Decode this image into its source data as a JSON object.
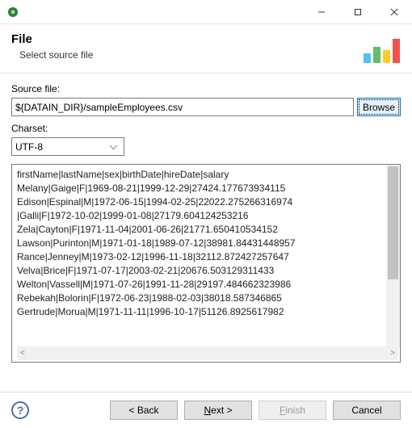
{
  "header": {
    "title": "File",
    "subtitle": "Select source file"
  },
  "source": {
    "label": "Source file:",
    "value": "${DATAIN_DIR}/sampleEmployees.csv",
    "browse_label": "Browse"
  },
  "charset": {
    "label": "Charset:",
    "value": "UTF-8"
  },
  "preview_lines": [
    "firstName|lastName|sex|birthDate|hireDate|salary",
    "Melany|Gaige|F|1969-08-21|1999-12-29|27424.177673934115",
    "Edison|Espinal|M|1972-06-15|1994-02-25|22022.275266316974",
    "|Galli|F|1972-10-02|1999-01-08|27179.604124253216",
    "Zela|Cayton|F|1971-11-04|2001-06-26|21771.650410534152",
    "Lawson|Purinton|M|1971-01-18|1989-07-12|38981.84431448957",
    "Rance|Jenney|M|1973-02-12|1996-11-18|32112.872427257647",
    "Velva|Brice|F|1971-07-17|2003-02-21|20676.503129311433",
    "Welton|Vassell|M|1971-07-26|1991-11-28|29197.484662323986",
    "Rebekah|Bolorin|F|1972-06-23|1988-02-03|38018.587346865",
    "Gertrude|Morua|M|1971-11-11|1996-10-17|51126.8925617982"
  ],
  "footer": {
    "back": "< Back",
    "next_prefix": "N",
    "next_suffix": "ext >",
    "finish_prefix": "F",
    "finish_suffix": "inish",
    "cancel": "Cancel"
  }
}
